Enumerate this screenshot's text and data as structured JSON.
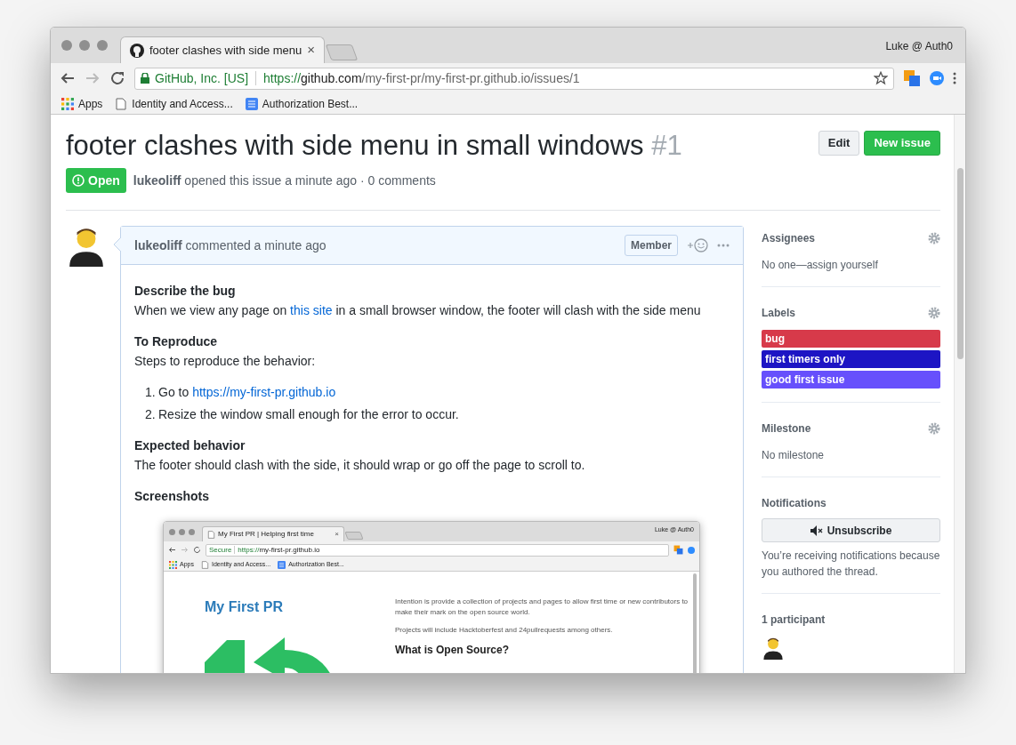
{
  "browser": {
    "tabs": [
      {
        "title": "footer clashes with side menu",
        "close": "×",
        "selected": true
      }
    ],
    "profile": "Luke @ Auth0",
    "security": "GitHub, Inc. [US]",
    "url_scheme": "https://",
    "url_host": "github.com",
    "url_path": "/my-first-pr/my-first-pr.github.io/issues/1",
    "bookmarks": [
      {
        "kind": "apps",
        "label": "Apps"
      },
      {
        "kind": "page",
        "label": "Identity and Access..."
      },
      {
        "kind": "doc",
        "label": "Authorization Best..."
      }
    ]
  },
  "issue": {
    "title": "footer clashes with side menu in small windows",
    "number": "#1",
    "state": "Open",
    "author": "lukeoliff",
    "meta": "opened this issue a minute ago · 0 comments",
    "buttons": [
      {
        "kind": "secondary",
        "label": "Edit"
      },
      {
        "kind": "primary",
        "label": "New issue"
      }
    ]
  },
  "comment": {
    "author": "lukeoliff",
    "action": "commented a minute ago",
    "badge": "Member",
    "body": [
      {
        "kind": "heading",
        "text": "Describe the bug"
      },
      {
        "kind": "paragraph",
        "parts": [
          {
            "kind": "text",
            "text": "When we view any page on "
          },
          {
            "kind": "link",
            "text": "this site"
          },
          {
            "kind": "text",
            "text": " in a small browser window, the footer will clash with the side menu"
          }
        ]
      },
      {
        "kind": "heading",
        "text": "To Reproduce"
      },
      {
        "kind": "paragraph",
        "parts": [
          {
            "kind": "text",
            "text": "Steps to reproduce the behavior:"
          }
        ]
      },
      {
        "kind": "list",
        "items": [
          {
            "number": "1.",
            "parts": [
              {
                "kind": "text",
                "text": "Go to "
              },
              {
                "kind": "link",
                "text": "https://my-first-pr.github.io"
              }
            ]
          },
          {
            "number": "2.",
            "parts": [
              {
                "kind": "text",
                "text": "Resize the window small enough for the error to occur."
              }
            ]
          }
        ]
      },
      {
        "kind": "heading",
        "text": "Expected behavior"
      },
      {
        "kind": "paragraph",
        "parts": [
          {
            "kind": "text",
            "text": "The footer should clash with the side, it should wrap or go off the page to scroll to."
          }
        ]
      },
      {
        "kind": "heading",
        "text": "Screenshots"
      },
      {
        "kind": "screenshot",
        "tab": "My First PR | Helping first time",
        "tab_close": "×",
        "profile": "Luke @ Auth0",
        "security": "Secure",
        "url_scheme": "https://",
        "url_rest": "my-first-pr.github.io",
        "bookmarks": [
          {
            "kind": "apps",
            "label": "Apps"
          },
          {
            "kind": "page",
            "label": "Identity and Access..."
          },
          {
            "kind": "doc",
            "label": "Authorization Best..."
          }
        ],
        "site_title": "My First PR",
        "paragraphs": [
          "Intention is provide a collection of projects and pages to allow first time or new contributors to make their mark on the open source world.",
          "Projects will include Hacktoberfest and 24pullrequests among others."
        ],
        "heading": "What is Open Source?"
      }
    ]
  },
  "sidebar": [
    {
      "kind": "text",
      "title": "Assignees",
      "gear": true,
      "text": "No one—assign yourself"
    },
    {
      "kind": "labels",
      "title": "Labels",
      "gear": true,
      "labels": [
        {
          "name": "bug",
          "color": "#d73a4a"
        },
        {
          "name": "first timers only",
          "color": "#1d15c4"
        },
        {
          "name": "good first issue",
          "color": "#6750fc"
        }
      ]
    },
    {
      "kind": "text",
      "title": "Milestone",
      "gear": true,
      "text": "No milestone"
    },
    {
      "kind": "notifications",
      "title": "Notifications",
      "gear": false,
      "button": "Unsubscribe",
      "text": "You’re receiving notifications because you authored the thread."
    },
    {
      "kind": "participants",
      "title": "1 participant",
      "gear": false
    }
  ]
}
